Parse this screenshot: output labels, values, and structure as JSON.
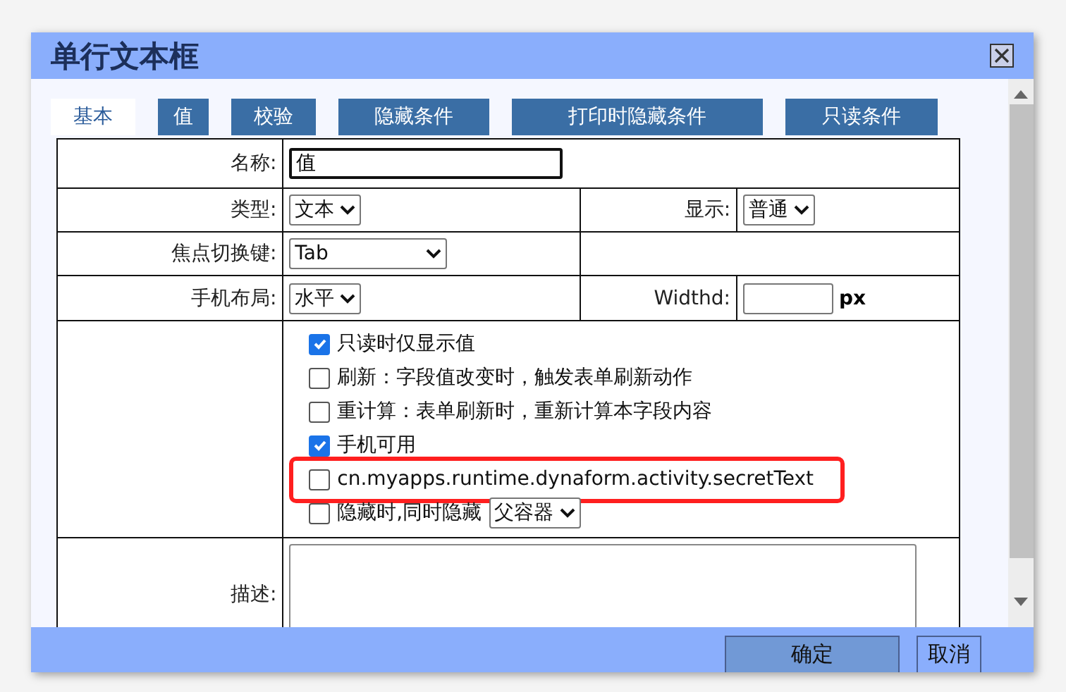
{
  "window": {
    "title": "单行文本框"
  },
  "tabs": [
    {
      "label": "基本",
      "selected": true
    },
    {
      "label": "值",
      "selected": false
    },
    {
      "label": "校验",
      "selected": false
    },
    {
      "label": "隐藏条件",
      "selected": false
    },
    {
      "label": "打印时隐藏条件",
      "selected": false
    },
    {
      "label": "只读条件",
      "selected": false
    }
  ],
  "form": {
    "name": {
      "label": "名称:",
      "value": "值"
    },
    "type": {
      "label": "类型:",
      "value": "文本"
    },
    "display": {
      "label": "显示:",
      "value": "普通"
    },
    "focus_key": {
      "label": "焦点切换键:",
      "value": "Tab"
    },
    "mobile_layout": {
      "label": "手机布局:",
      "value": "水平"
    },
    "width": {
      "label": "Widthd:",
      "unit": "px"
    },
    "options": [
      {
        "kind": "check",
        "label": "只读时仅显示值",
        "checked": true,
        "highlighted": false
      },
      {
        "kind": "check",
        "label": "刷新：字段值改变时，触发表单刷新动作",
        "checked": false,
        "highlighted": false
      },
      {
        "kind": "check",
        "label": "重计算：表单刷新时，重新计算本字段内容",
        "checked": false,
        "highlighted": false
      },
      {
        "kind": "check",
        "label": "手机可用",
        "checked": true,
        "highlighted": false
      },
      {
        "kind": "check",
        "label": "cn.myapps.runtime.dynaform.activity.secretText",
        "checked": false,
        "highlighted": true
      },
      {
        "kind": "check-select",
        "label": "隐藏时,同时隐藏",
        "checked": false,
        "highlighted": false,
        "value": "父容器"
      }
    ],
    "description": {
      "label": "描述:"
    }
  },
  "buttons": [
    {
      "label": "确定",
      "focused": true
    },
    {
      "label": "取消",
      "focused": false
    }
  ]
}
